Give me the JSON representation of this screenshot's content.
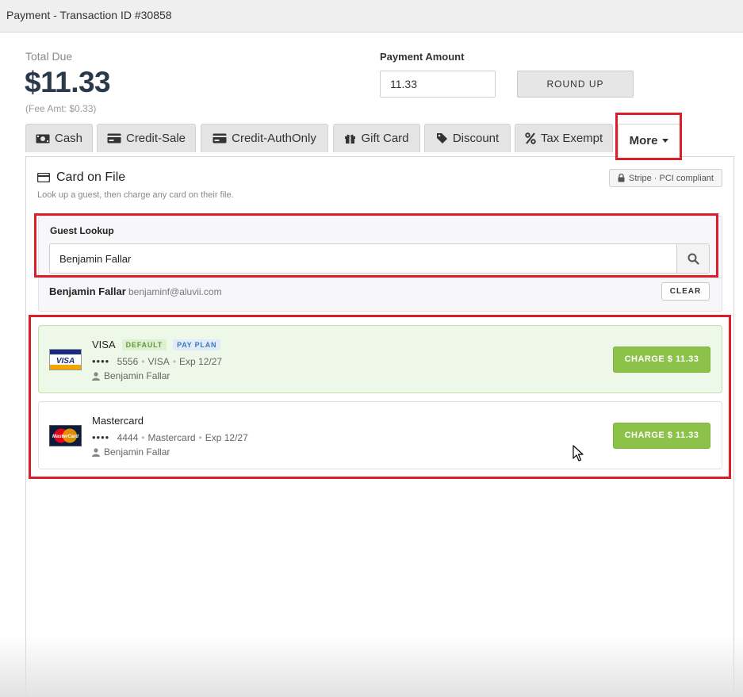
{
  "window": {
    "title": "Payment - Transaction ID #30858"
  },
  "summary": {
    "total_due_label": "Total Due",
    "total_due_value": "$11.33",
    "fee_text": "(Fee Amt: $0.33)",
    "payment_amount_label": "Payment Amount",
    "payment_amount_value": "11.33",
    "round_up_label": "ROUND UP"
  },
  "tabs": [
    {
      "label": "Cash",
      "icon": "cash-icon"
    },
    {
      "label": "Credit-Sale",
      "icon": "credit-card-icon"
    },
    {
      "label": "Credit-AuthOnly",
      "icon": "credit-card-icon"
    },
    {
      "label": "Gift Card",
      "icon": "gift-icon"
    },
    {
      "label": "Discount",
      "icon": "tag-icon"
    },
    {
      "label": "Tax Exempt",
      "icon": "percent-icon"
    },
    {
      "label": "More",
      "icon": "caret-down-icon",
      "active": true
    }
  ],
  "card_on_file": {
    "title": "Card on File",
    "subtitle": "Look up a guest, then charge any card on their file.",
    "stripe_badge": "Stripe · PCI compliant"
  },
  "guest_lookup": {
    "label": "Guest Lookup",
    "value": "Benjamin Fallar",
    "selected_name": "Benjamin Fallar",
    "selected_email": "benjaminf@aluvii.com",
    "clear_label": "CLEAR"
  },
  "cards": [
    {
      "brand": "VISA",
      "badges": [
        "DEFAULT",
        "PAY PLAN"
      ],
      "dots": "••••",
      "last4": "5556",
      "network": "VISA",
      "expiry": "Exp 12/27",
      "holder": "Benjamin Fallar",
      "charge_label": "CHARGE $ 11.33",
      "logo_text": "VISA"
    },
    {
      "brand": "Mastercard",
      "badges": [],
      "dots": "••••",
      "last4": "4444",
      "network": "Mastercard",
      "expiry": "Exp 12/27",
      "holder": "Benjamin Fallar",
      "charge_label": "CHARGE $ 11.33",
      "logo_text": "MasterCard"
    }
  ],
  "colors": {
    "highlight": "#d9202a",
    "charge_green": "#8cc14a",
    "default_card_bg": "#eef8e8",
    "total_due": "#2b3a4a"
  }
}
